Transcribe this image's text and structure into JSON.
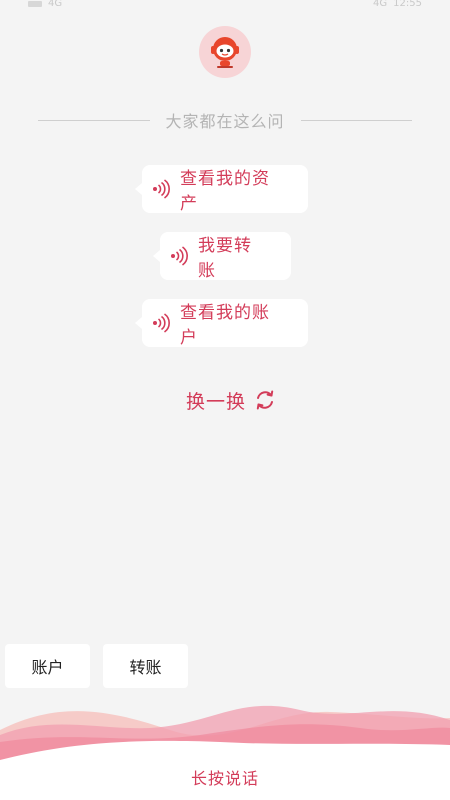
{
  "status_bar": {
    "time": "12:55",
    "left_text": "4G",
    "right_text": "4G"
  },
  "header": {
    "prompt": "大家都在这么问"
  },
  "suggestions": [
    {
      "text": "查看我的资产"
    },
    {
      "text": "我要转账"
    },
    {
      "text": "查看我的账户"
    }
  ],
  "refresh": {
    "label": "换一换"
  },
  "quick_buttons": {
    "account": "账户",
    "transfer": "转账"
  },
  "bottom": {
    "hold_to_talk": "长按说话"
  },
  "icons": {
    "avatar": "robot-avatar-icon",
    "suggestion": "sound-wave-icon",
    "refresh": "refresh-icon"
  },
  "colors": {
    "accent": "#d33c59",
    "background": "#f4f4f4",
    "wave": "#f29fb0"
  }
}
